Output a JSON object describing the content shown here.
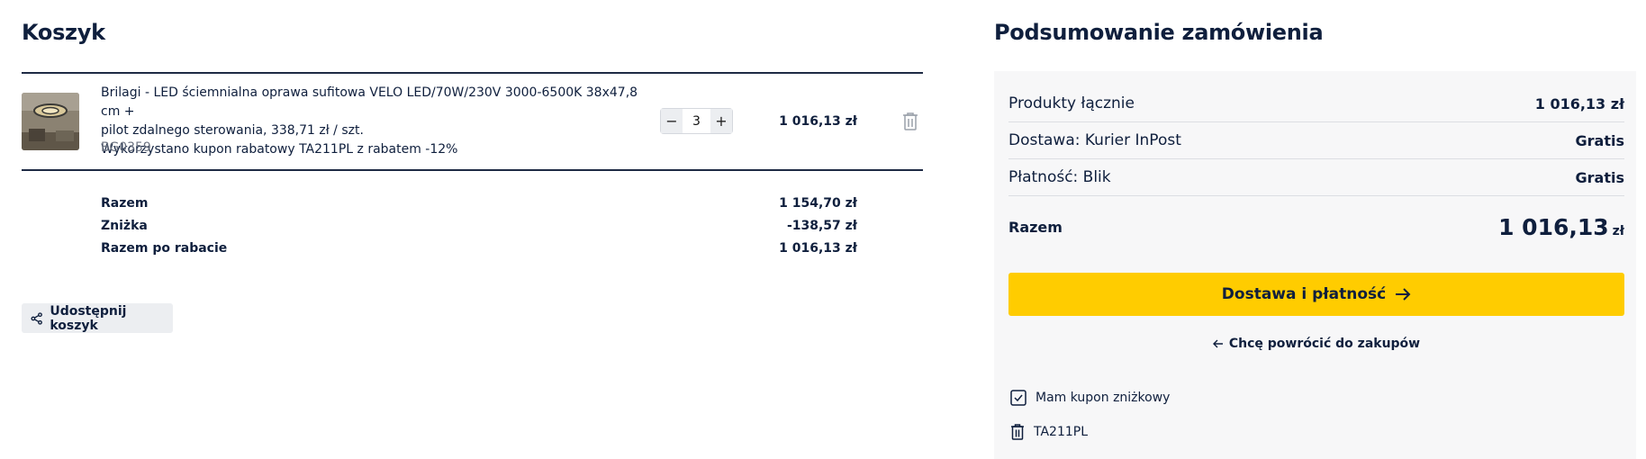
{
  "cart": {
    "title": "Koszyk",
    "item": {
      "name_line1": "Brilagi - LED ściemnialna oprawa sufitowa VELO LED/70W/230V 3000-6500K 38x47,8 cm +",
      "name_line2": "pilot zdalnego sterowania, 338,71 zł / szt.",
      "coupon_note": "Wykorzystano kupon rabatowy TA211PL z rabatem -12%",
      "sku": "BG0359",
      "quantity": "3",
      "minus": "−",
      "plus": "+",
      "price": "1 016,13 zł",
      "image_icon": "product-thumbnail",
      "delete_icon": "trash-icon"
    },
    "totals": [
      {
        "label": "Razem",
        "value": "1 154,70 zł"
      },
      {
        "label": "Zniżka",
        "value": "-138,57 zł"
      },
      {
        "label": "Razem po rabacie",
        "value": "1 016,13 zł"
      }
    ],
    "share_label": "Udostępnij koszyk",
    "share_icon": "share-icon"
  },
  "summary": {
    "title": "Podsumowanie zamówienia",
    "rows": [
      {
        "label": "Produkty łącznie",
        "value": "1 016,13 zł"
      },
      {
        "label": "Dostawa: Kurier InPost",
        "value": "Gratis"
      },
      {
        "label": "Płatność: Blik",
        "value": "Gratis"
      }
    ],
    "total_label": "Razem",
    "total_amount": "1 016,13",
    "total_currency": "zł",
    "cta_label": "Dostawa i płatność",
    "back_label": "Chcę powrócić do zakupów",
    "coupon_toggle_label": "Mam kupon zniżkowy",
    "coupon_code": "TA211PL"
  },
  "colors": {
    "accent": "#ffcc00",
    "text": "#0f1f3d",
    "panel": "#f7f7f8"
  }
}
